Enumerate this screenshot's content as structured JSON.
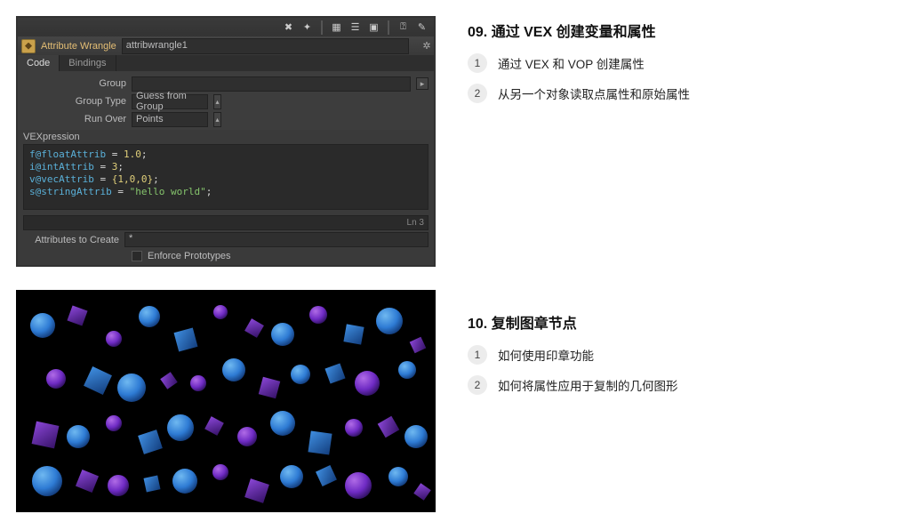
{
  "houdini": {
    "node_type": "Attribute Wrangle",
    "node_name": "attribwrangle1",
    "tabs": {
      "code": "Code",
      "bindings": "Bindings"
    },
    "params": {
      "group_label": "Group",
      "group_value": "",
      "group_type_label": "Group Type",
      "group_type_value": "Guess from Group",
      "run_over_label": "Run Over",
      "run_over_value": "Points"
    },
    "vex_label": "VEXpression",
    "code": {
      "line1_attr": "f@floatAttrib",
      "line1_val": "1.0",
      "line2_attr": "i@intAttrib",
      "line2_val": "3",
      "line3_attr": "v@vecAttrib",
      "line3_val": "{1,0,0}",
      "line4_attr": "s@stringAttrib",
      "line4_val": "\"hello world\""
    },
    "error_line": "Ln 3",
    "attrs_create_label": "Attributes to Create",
    "attrs_create_value": "*",
    "enforce_label": "Enforce Prototypes"
  },
  "lessons": [
    {
      "title": "09. 通过 VEX 创建变量和属性",
      "items": [
        "通过 VEX 和 VOP 创建属性",
        "从另一个对象读取点属性和原始属性"
      ]
    },
    {
      "title": "10. 复制图章节点",
      "items": [
        "如何使用印章功能",
        "如何将属性应用于复制的几何图形"
      ]
    }
  ]
}
